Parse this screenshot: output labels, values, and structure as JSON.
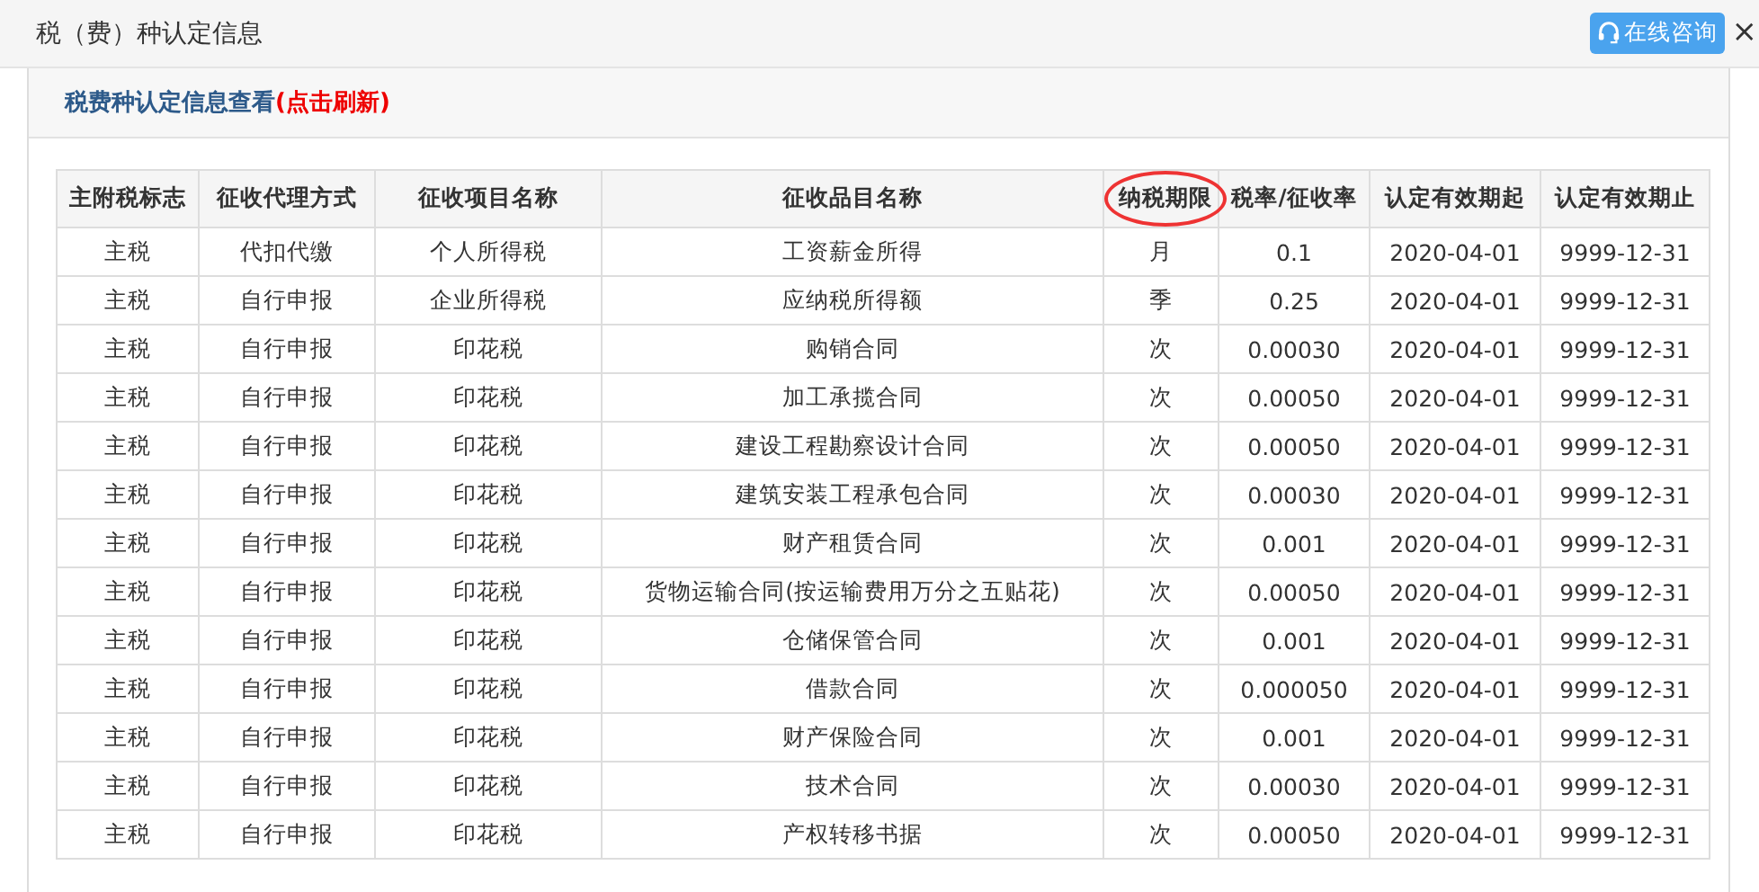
{
  "window": {
    "title": "税（费）种认定信息",
    "consult_button": "在线咨询",
    "close": "×"
  },
  "panel": {
    "title": "税费种认定信息查看",
    "refresh_link": "(点击刷新)"
  },
  "table": {
    "columns": [
      {
        "label": "主附税标志",
        "circled": false
      },
      {
        "label": "征收代理方式",
        "circled": false
      },
      {
        "label": "征收项目名称",
        "circled": false
      },
      {
        "label": "征收品目名称",
        "circled": false
      },
      {
        "label": "纳税期限",
        "circled": true
      },
      {
        "label": "税率/征收率",
        "circled": false
      },
      {
        "label": "认定有效期起",
        "circled": false
      },
      {
        "label": "认定有效期止",
        "circled": false
      }
    ],
    "rows": [
      [
        "主税",
        "代扣代缴",
        "个人所得税",
        "工资薪金所得",
        "月",
        "0.1",
        "2020-04-01",
        "9999-12-31"
      ],
      [
        "主税",
        "自行申报",
        "企业所得税",
        "应纳税所得额",
        "季",
        "0.25",
        "2020-04-01",
        "9999-12-31"
      ],
      [
        "主税",
        "自行申报",
        "印花税",
        "购销合同",
        "次",
        "0.00030",
        "2020-04-01",
        "9999-12-31"
      ],
      [
        "主税",
        "自行申报",
        "印花税",
        "加工承揽合同",
        "次",
        "0.00050",
        "2020-04-01",
        "9999-12-31"
      ],
      [
        "主税",
        "自行申报",
        "印花税",
        "建设工程勘察设计合同",
        "次",
        "0.00050",
        "2020-04-01",
        "9999-12-31"
      ],
      [
        "主税",
        "自行申报",
        "印花税",
        "建筑安装工程承包合同",
        "次",
        "0.00030",
        "2020-04-01",
        "9999-12-31"
      ],
      [
        "主税",
        "自行申报",
        "印花税",
        "财产租赁合同",
        "次",
        "0.001",
        "2020-04-01",
        "9999-12-31"
      ],
      [
        "主税",
        "自行申报",
        "印花税",
        "货物运输合同(按运输费用万分之五贴花)",
        "次",
        "0.00050",
        "2020-04-01",
        "9999-12-31"
      ],
      [
        "主税",
        "自行申报",
        "印花税",
        "仓储保管合同",
        "次",
        "0.001",
        "2020-04-01",
        "9999-12-31"
      ],
      [
        "主税",
        "自行申报",
        "印花税",
        "借款合同",
        "次",
        "0.000050",
        "2020-04-01",
        "9999-12-31"
      ],
      [
        "主税",
        "自行申报",
        "印花税",
        "财产保险合同",
        "次",
        "0.001",
        "2020-04-01",
        "9999-12-31"
      ],
      [
        "主税",
        "自行申报",
        "印花税",
        "技术合同",
        "次",
        "0.00030",
        "2020-04-01",
        "9999-12-31"
      ],
      [
        "主税",
        "自行申报",
        "印花税",
        "产权转移书据",
        "次",
        "0.00050",
        "2020-04-01",
        "9999-12-31"
      ]
    ]
  }
}
